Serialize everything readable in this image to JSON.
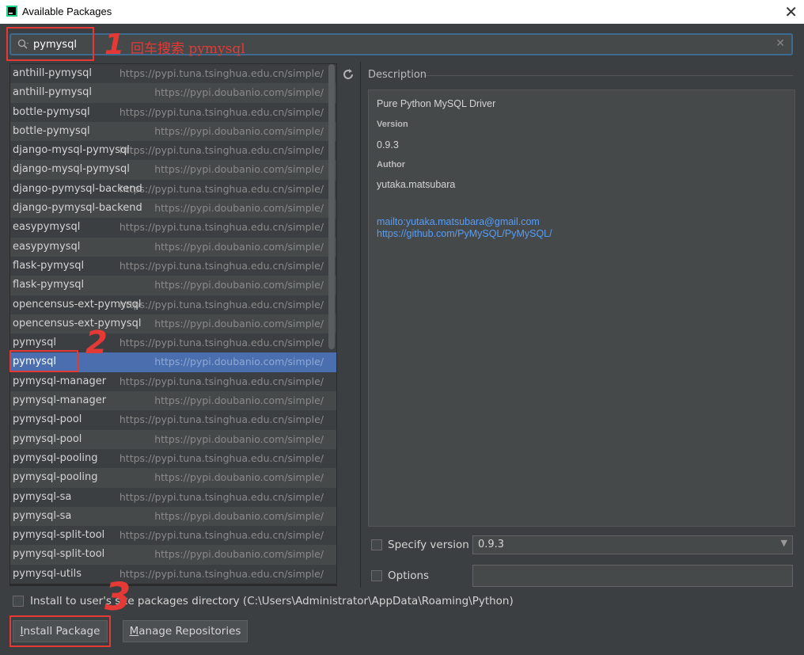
{
  "window": {
    "title": "Available Packages",
    "close_glyph": "✕"
  },
  "search": {
    "value": "pymysql",
    "clear_glyph": "✕"
  },
  "annotations": {
    "step1_num": "1",
    "step1_text": "回车搜索 pymysql",
    "step2_num": "2",
    "step3_num": "3"
  },
  "packages": [
    {
      "name": "anthill-pymysql",
      "repo": "https://pypi.tuna.tsinghua.edu.cn/simple/"
    },
    {
      "name": "anthill-pymysql",
      "repo": "https://pypi.doubanio.com/simple/"
    },
    {
      "name": "bottle-pymysql",
      "repo": "https://pypi.tuna.tsinghua.edu.cn/simple/"
    },
    {
      "name": "bottle-pymysql",
      "repo": "https://pypi.doubanio.com/simple/"
    },
    {
      "name": "django-mysql-pymysql",
      "repo": "https://pypi.tuna.tsinghua.edu.cn/simple/"
    },
    {
      "name": "django-mysql-pymysql",
      "repo": "https://pypi.doubanio.com/simple/"
    },
    {
      "name": "django-pymysql-backend",
      "repo": "https://pypi.tuna.tsinghua.edu.cn/simple/"
    },
    {
      "name": "django-pymysql-backend",
      "repo": "https://pypi.doubanio.com/simple/"
    },
    {
      "name": "easypymysql",
      "repo": "https://pypi.tuna.tsinghua.edu.cn/simple/"
    },
    {
      "name": "easypymysql",
      "repo": "https://pypi.doubanio.com/simple/"
    },
    {
      "name": "flask-pymysql",
      "repo": "https://pypi.tuna.tsinghua.edu.cn/simple/"
    },
    {
      "name": "flask-pymysql",
      "repo": "https://pypi.doubanio.com/simple/"
    },
    {
      "name": "opencensus-ext-pymysql",
      "repo": "https://pypi.tuna.tsinghua.edu.cn/simple/"
    },
    {
      "name": "opencensus-ext-pymysql",
      "repo": "https://pypi.doubanio.com/simple/"
    },
    {
      "name": "pymysql",
      "repo": "https://pypi.tuna.tsinghua.edu.cn/simple/"
    },
    {
      "name": "pymysql",
      "repo": "https://pypi.doubanio.com/simple/",
      "selected": true
    },
    {
      "name": "pymysql-manager",
      "repo": "https://pypi.tuna.tsinghua.edu.cn/simple/"
    },
    {
      "name": "pymysql-manager",
      "repo": "https://pypi.doubanio.com/simple/"
    },
    {
      "name": "pymysql-pool",
      "repo": "https://pypi.tuna.tsinghua.edu.cn/simple/"
    },
    {
      "name": "pymysql-pool",
      "repo": "https://pypi.doubanio.com/simple/"
    },
    {
      "name": "pymysql-pooling",
      "repo": "https://pypi.tuna.tsinghua.edu.cn/simple/"
    },
    {
      "name": "pymysql-pooling",
      "repo": "https://pypi.doubanio.com/simple/"
    },
    {
      "name": "pymysql-sa",
      "repo": "https://pypi.tuna.tsinghua.edu.cn/simple/"
    },
    {
      "name": "pymysql-sa",
      "repo": "https://pypi.doubanio.com/simple/"
    },
    {
      "name": "pymysql-split-tool",
      "repo": "https://pypi.tuna.tsinghua.edu.cn/simple/"
    },
    {
      "name": "pymysql-split-tool",
      "repo": "https://pypi.doubanio.com/simple/"
    },
    {
      "name": "pymysql-utils",
      "repo": "https://pypi.tuna.tsinghua.edu.cn/simple/"
    }
  ],
  "description": {
    "label": "Description",
    "summary": "Pure Python MySQL Driver",
    "version_label": "Version",
    "version": "0.9.3",
    "author_label": "Author",
    "author": "yutaka.matsubara",
    "link_mail": "mailto:yutaka.matsubara@gmail.com",
    "link_github": "https://github.com/PyMySQL/PyMySQL/"
  },
  "options": {
    "specify_version_label": "Specify version",
    "specify_version_value": "0.9.3",
    "options_label": "Options",
    "options_value": "",
    "install_user_label": "Install to user's site packages directory (C:\\Users\\Administrator\\AppData\\Roaming\\Python)"
  },
  "buttons": {
    "install_mnemonic": "I",
    "install_rest": "nstall Package",
    "manage_mnemonic": "M",
    "manage_rest": "anage Repositories"
  },
  "colors": {
    "accent": "#4b6eaf",
    "annotation": "#e53935",
    "link": "#589df6"
  }
}
